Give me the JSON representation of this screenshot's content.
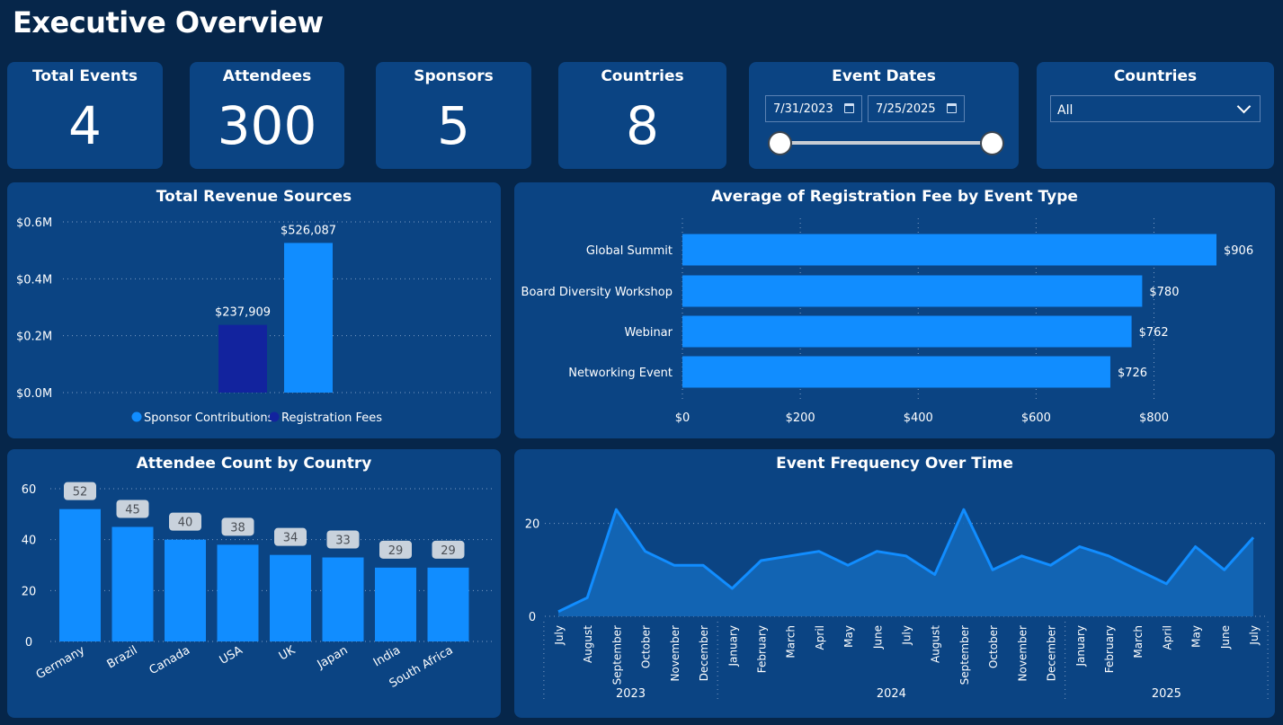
{
  "page": {
    "title": "Executive Overview"
  },
  "kpis": {
    "events": {
      "label": "Total Events",
      "value": "4"
    },
    "attendees": {
      "label": "Attendees",
      "value": "300"
    },
    "sponsors": {
      "label": "Sponsors",
      "value": "5"
    },
    "countries": {
      "label": "Countries",
      "value": "8"
    }
  },
  "date_slicer": {
    "title": "Event Dates",
    "start": "7/31/2023",
    "end": "7/25/2025",
    "range_fraction": [
      0,
      1
    ]
  },
  "country_slicer": {
    "title": "Countries",
    "selected": "All"
  },
  "colors": {
    "bright_blue": "#118dff",
    "dark_blue": "#12239e",
    "panel": "#0b4483",
    "background": "#06264a",
    "label_bg": "#c9d2dc"
  },
  "chart_data": [
    {
      "id": "revenue",
      "type": "bar",
      "title": "Total Revenue Sources",
      "categories": [
        "Sponsor Contributions",
        "Registration Fees"
      ],
      "values": [
        237909,
        526087
      ],
      "data_labels": [
        "$237,909",
        "$526,087"
      ],
      "legend": [
        "Sponsor Contributions",
        "Registration Fees"
      ],
      "y_ticks": [
        0,
        200000,
        400000,
        600000
      ],
      "y_tick_labels": [
        "$0.0M",
        "$0.2M",
        "$0.4M",
        "$0.6M"
      ],
      "ylim": [
        0,
        600000
      ],
      "grid": true,
      "legend_position": "bottom"
    },
    {
      "id": "regfee",
      "type": "bar",
      "orientation": "horizontal",
      "title": "Average of Registration Fee by Event Type",
      "categories": [
        "Global Summit",
        "Board Diversity Workshop",
        "Webinar",
        "Networking Event"
      ],
      "values": [
        906,
        780,
        762,
        726
      ],
      "data_labels": [
        "$906",
        "$780",
        "$762",
        "$726"
      ],
      "x_ticks": [
        0,
        200,
        400,
        600,
        800
      ],
      "x_tick_labels": [
        "$0",
        "$200",
        "$400",
        "$600",
        "$800"
      ],
      "xlim": [
        0,
        906
      ],
      "grid": true
    },
    {
      "id": "attendees",
      "type": "bar",
      "title": "Attendee Count by Country",
      "categories": [
        "Germany",
        "Brazil",
        "Canada",
        "USA",
        "UK",
        "Japan",
        "India",
        "South Africa"
      ],
      "values": [
        52,
        45,
        40,
        38,
        34,
        33,
        29,
        29
      ],
      "y_ticks": [
        0,
        20,
        40,
        60
      ],
      "ylim": [
        0,
        60
      ],
      "grid": true
    },
    {
      "id": "frequency",
      "type": "area",
      "title": "Event Frequency Over Time",
      "x": [
        "July",
        "August",
        "September",
        "October",
        "November",
        "December",
        "January",
        "February",
        "March",
        "April",
        "May",
        "June",
        "July",
        "August",
        "September",
        "October",
        "November",
        "December",
        "January",
        "February",
        "March",
        "April",
        "May",
        "June",
        "July"
      ],
      "values": [
        1,
        4,
        23,
        14,
        11,
        11,
        6,
        12,
        13,
        14,
        11,
        14,
        13,
        9,
        23,
        10,
        13,
        11,
        15,
        13,
        10,
        7,
        15,
        10,
        17
      ],
      "year_groups": [
        {
          "label": "2023",
          "start": 0,
          "end": 5
        },
        {
          "label": "2024",
          "start": 6,
          "end": 17
        },
        {
          "label": "2025",
          "start": 18,
          "end": 24
        }
      ],
      "y_ticks": [
        0,
        20
      ],
      "ylim": [
        0,
        24
      ],
      "grid": true
    }
  ]
}
